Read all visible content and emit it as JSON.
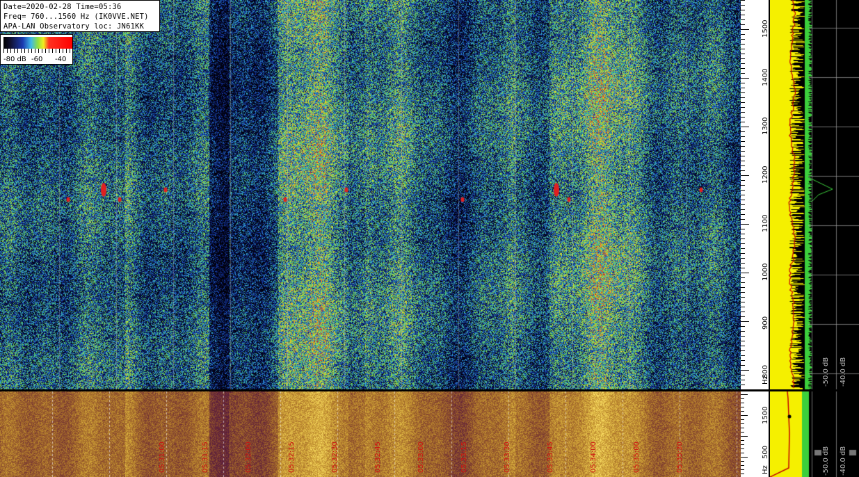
{
  "header": {
    "line1": "Date=2020-02-28 Time=05:36",
    "line2": "Freq= 760...1560 Hz (IK0VVE.NET)",
    "line3": "APA-LAN Observatory loc: JN61KK"
  },
  "legend": {
    "labels": [
      "-80 dB",
      "-60",
      "-40"
    ]
  },
  "colors": {
    "waterfall_low": "#0a1a5a",
    "waterfall_mid": "#5ec24a",
    "waterfall_high": "#e03020",
    "spectrum_yellow": "#f5f000",
    "spectrum_green": "#3ccf3c",
    "timestamp_red": "#d01010"
  },
  "chart_data": [
    {
      "type": "heatmap",
      "panel": "main-waterfall",
      "yunit": "Hz",
      "yticks": [
        "800",
        "900",
        "1000",
        "1100",
        "1200",
        "1300",
        "1400",
        "1500"
      ],
      "ylim": [
        760,
        1560
      ],
      "signals_hz": [
        1150,
        1170
      ]
    },
    {
      "type": "heatmap",
      "panel": "overview-waterfall",
      "yunit": "Hz",
      "yticks": [
        "500",
        "1500"
      ],
      "time_labels": [
        "05:31:00",
        "05:31:15",
        "05:32:00",
        "05:32:15",
        "05:32:30",
        "05:32:45",
        "05:33:00",
        "05:33:15",
        "05:33:30",
        "05:33:45",
        "05:34:00",
        "05:35:00",
        "05:35:30"
      ]
    },
    {
      "type": "line",
      "panel": "spectrum",
      "xticks": [
        "-50.0 dB",
        "-40.0 dB"
      ]
    }
  ]
}
